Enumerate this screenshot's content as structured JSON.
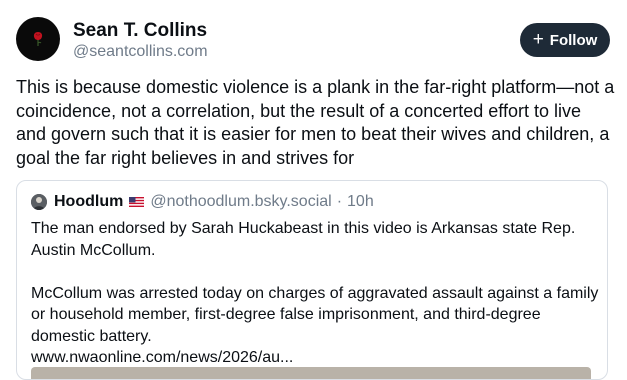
{
  "post": {
    "author": {
      "name": "Sean T. Collins",
      "handle": "@seantcollins.com"
    },
    "follow_label": "Follow",
    "text": "This is because domestic violence is a plank in the far-right platform—not a coincidence, not a correlation, but the result of a concerted effort to live and govern such that it is easier for men to beat their wives and children, a goal the far right believes in and strives for"
  },
  "quote": {
    "author_name": "Hoodlum",
    "handle": "@nothoodlum.bsky.social",
    "separator": "·",
    "time": "10h",
    "paragraph1": "The man endorsed by Sarah Huckabeast in this video is Arkansas state Rep. Austin McCollum.",
    "paragraph2": "McCollum was arrested today on charges of aggravated assault against a family or household member, first-degree false imprisonment, and third-degree domestic battery.",
    "link": "www.nwaonline.com/news/2026/au..."
  },
  "colors": {
    "follow_button_bg": "#1e2a37",
    "handle_gray": "#6f7b89",
    "card_border": "#d9dee5"
  },
  "icons": {
    "avatar": "rose-icon",
    "follow": "plus-icon",
    "flag": "us-flag-icon"
  }
}
